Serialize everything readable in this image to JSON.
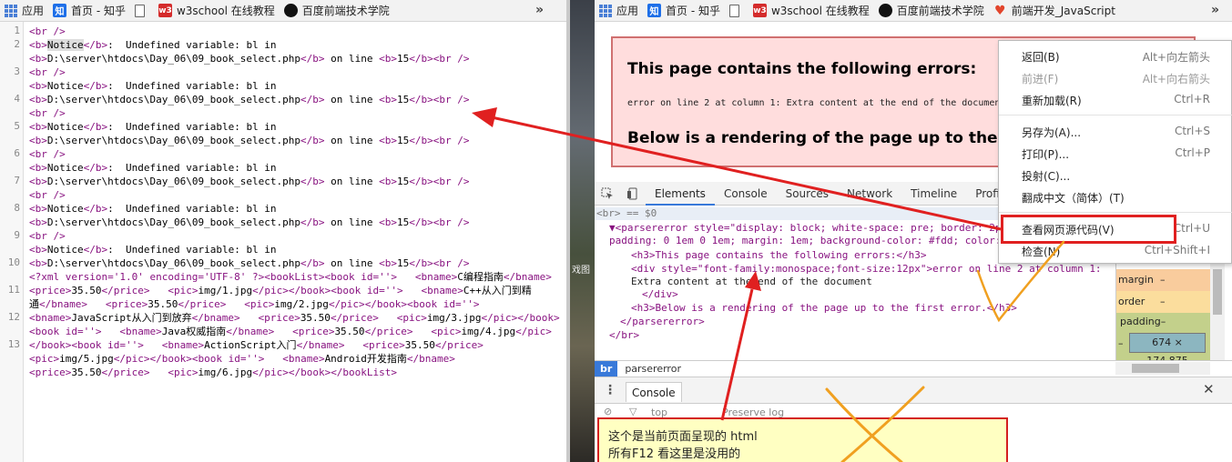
{
  "left_bookmarks": {
    "items": [
      "应用",
      "首页 - 知乎",
      "",
      "w3school 在线教程",
      "百度前端技术学院"
    ],
    "more": "»",
    "w3": "w3",
    "zhi": "知"
  },
  "right_bookmarks": {
    "items": [
      "应用",
      "首页 - 知乎",
      "",
      "w3school 在线教程",
      "百度前端技术学院",
      "前端开发_JavaScript"
    ],
    "more": "»",
    "w3": "w3",
    "zhi": "知"
  },
  "source": {
    "line_numbers": [
      "1",
      "2",
      "3",
      "4",
      "5",
      "6",
      "7",
      "8",
      "9",
      "10",
      "11",
      "12",
      "13"
    ],
    "br_tag": "<br />",
    "notice_open": "<b>",
    "notice_word": "Notice",
    "notice_close": "</b>",
    "notice_msg": ":  Undefined variable: bl in",
    "path_open": "<b>",
    "path": "D:\\server\\htdocs\\Day_06\\09_book_select.php",
    "path_close": "</b>",
    "on_line": " on line ",
    "line_open": "<b>",
    "line_num": "15",
    "line_close": "</b>",
    "br_end": "<br />",
    "xml_lines": [
      "<?xml version='1.0' encoding='UTF-8' ?><bookList><book id=''>   <bname>C编程指南</bname>",
      "<price>35.50</price>   <pic>img/1.jpg</pic></book><book id=''>   <bname>C++从入门到精",
      "通</bname>   <price>35.50</price>   <pic>img/2.jpg</pic></book><book id=''>",
      "<bname>JavaScript从入门到放弃</bname>   <price>35.50</price>   <pic>img/3.jpg</pic></book>",
      "<book id=''>   <bname>Java权威指南</bname>   <price>35.50</price>   <pic>img/4.jpg</pic>",
      "</book><book id=''>   <bname>ActionScript入门</bname>   <price>35.50</price>",
      "<pic>img/5.jpg</pic></book><book id=''>   <bname>Android开发指南</bname>",
      "<price>35.50</price>   <pic>img/6.jpg</pic></book></bookList>"
    ]
  },
  "page_errors": {
    "heading1": "This page contains the following errors:",
    "message": "error on line 2 at column 1: Extra content at the end of the document",
    "heading2": "Below is a rendering of the page up to the first error."
  },
  "devtools": {
    "tabs": [
      "Elements",
      "Console",
      "Sources",
      "Network",
      "Timeline",
      "Profiles"
    ],
    "elements": [
      "<br> == $0",
      "▼<parsererror style=\"display: block; white-space: pre; border: 2px",
      "padding: 0 1em 0 1em; margin: 1em; background-color: #fdd; color: b",
      "<h3>This page contains the following errors:</h3>",
      "<div style=\"font-family:monospace;font-size:12px\">error on line 2 at column 1:",
      "Extra content at the end of the document",
      "</div>",
      "<h3>Below is a rendering of the page up to the first error.</h3>",
      "</parsererror>",
      "</br>"
    ],
    "box_model": {
      "margin": "margin",
      "border": "order",
      "padding": "padding–",
      "dash": "–",
      "size": "674 × 174.875"
    },
    "crumb_badge": "br",
    "crumb_name": "parsererror",
    "console_tab": "Console",
    "filter_top": "top",
    "preserve_log": "Preserve log",
    "close": "✕"
  },
  "context_menu": {
    "items": [
      {
        "label": "返回(B)",
        "shortcut": "Alt+向左箭头",
        "disabled": false
      },
      {
        "label": "前进(F)",
        "shortcut": "Alt+向右箭头",
        "disabled": true
      },
      {
        "label": "重新加载(R)",
        "shortcut": "Ctrl+R",
        "disabled": false
      },
      {
        "label": "另存为(A)...",
        "shortcut": "Ctrl+S",
        "disabled": false
      },
      {
        "label": "打印(P)...",
        "shortcut": "Ctrl+P",
        "disabled": false
      },
      {
        "label": "投射(C)...",
        "shortcut": "",
        "disabled": false
      },
      {
        "label": "翻成中文（简体）(T)",
        "shortcut": "",
        "disabled": false
      },
      {
        "label": "查看网页源代码(V)",
        "shortcut": "Ctrl+U",
        "disabled": false
      },
      {
        "label": "检查(N)",
        "shortcut": "Ctrl+Shift+I",
        "disabled": false
      }
    ]
  },
  "note": {
    "line1": "这个是当前页面呈现的 html",
    "line2": "所有F12 看这里是没用的"
  },
  "strip_text": "戏图",
  "colors": {
    "tag": "#881280",
    "annotation_red": "#e02020",
    "annotation_orange": "#f0a020",
    "note_bg": "#ffffc2"
  }
}
